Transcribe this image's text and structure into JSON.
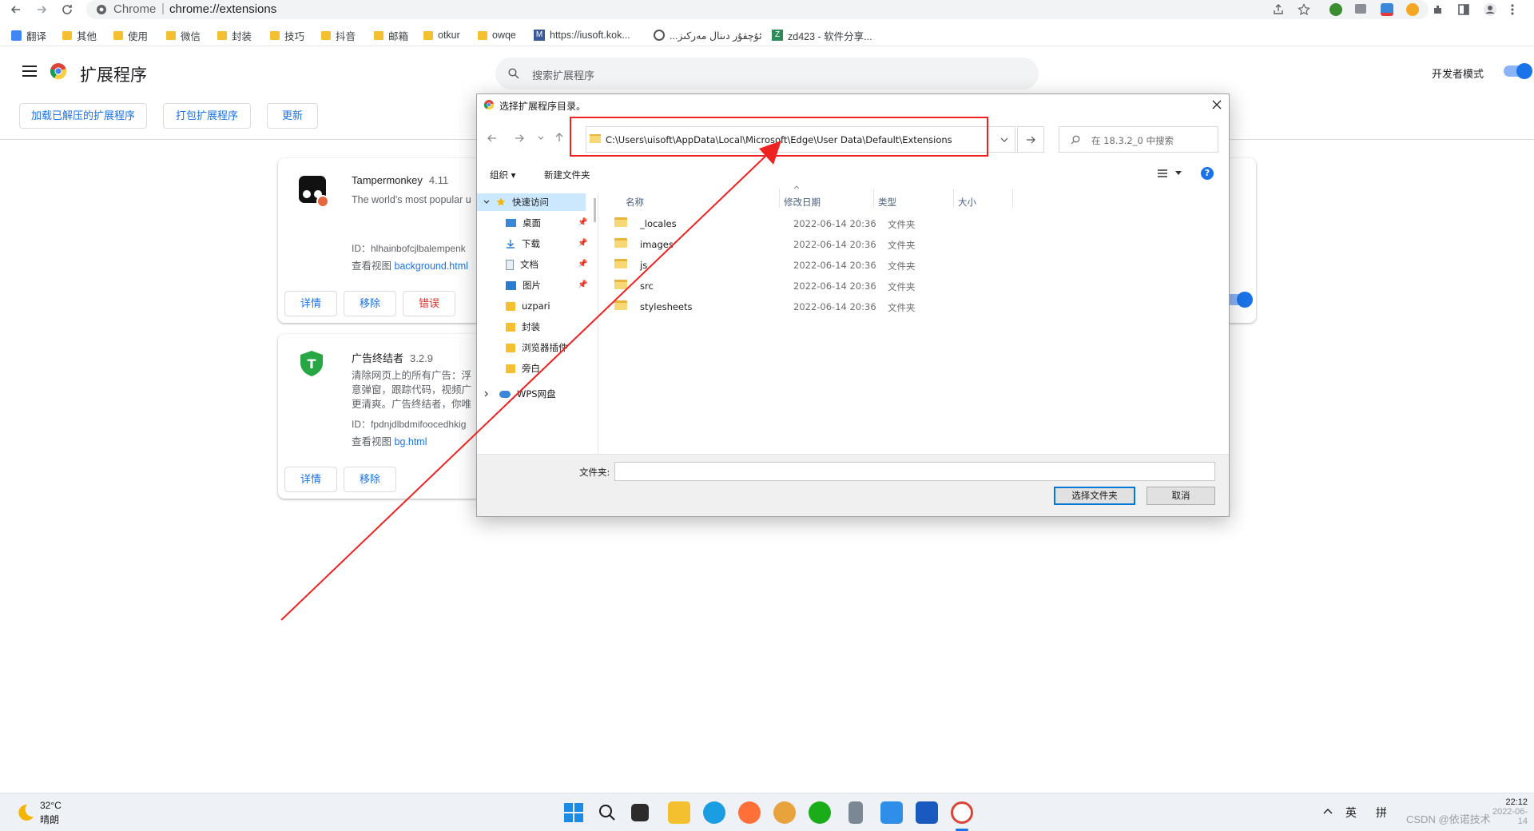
{
  "browser": {
    "site_label": "Chrome",
    "url": "chrome://extensions",
    "bookmarks": [
      {
        "label": "翻译",
        "icon": "translate-icon"
      },
      {
        "label": "其他",
        "icon": "folder-icon"
      },
      {
        "label": "使用",
        "icon": "folder-icon"
      },
      {
        "label": "微信",
        "icon": "folder-icon"
      },
      {
        "label": "封装",
        "icon": "folder-icon"
      },
      {
        "label": "技巧",
        "icon": "folder-icon"
      },
      {
        "label": "抖音",
        "icon": "folder-icon"
      },
      {
        "label": "邮箱",
        "icon": "folder-icon"
      },
      {
        "label": "otkur",
        "icon": "folder-icon"
      },
      {
        "label": "owqe",
        "icon": "folder-icon"
      },
      {
        "label": "https://iusoft.kok...",
        "icon": "site-m-icon"
      },
      {
        "label": "...ئۇچقۇر دىنال مەركىز",
        "icon": "wordpress-icon"
      },
      {
        "label": "zd423 - 软件分享...",
        "icon": "site-z-icon"
      }
    ]
  },
  "extensions_page": {
    "title": "扩展程序",
    "search_placeholder": "搜索扩展程序",
    "developer_mode_label": "开发者模式",
    "developer_mode_on": true,
    "buttons": {
      "load_unpacked": "加载已解压的扩展程序",
      "pack": "打包扩展程序",
      "update": "更新"
    },
    "cards": [
      {
        "name": "Tampermonkey",
        "version": "4.11",
        "description": "The world's most popular u",
        "id_text": "ID：hlhainbofcjlbalempenk",
        "views_label": "查看视图",
        "views_link": "background.html",
        "details_label": "详情",
        "remove_label": "移除",
        "errors_label": "错误"
      },
      {
        "name": "广告终结者",
        "version": "3.2.9",
        "description": "清除网页上的所有广告：浮意弹窗，跟踪代码，视频广更清爽。广告终结者，你唯",
        "id_text": "ID：fpdnjdlbdmifoocedhkig",
        "views_label": "查看视图",
        "views_link": "bg.html",
        "details_label": "详情",
        "remove_label": "移除"
      }
    ]
  },
  "dialog": {
    "title": "选择扩展程序目录。",
    "address_path": "C:\\Users\\uisoft\\AppData\\Local\\Microsoft\\Edge\\User Data\\Default\\Extensions",
    "search_placeholder": "在 18.3.2_0 中搜索",
    "organize_label": "组织 ▾",
    "new_folder_label": "新建文件夹",
    "nav": [
      {
        "label": "快速访问",
        "icon": "star-icon",
        "selected": true,
        "pinned": false
      },
      {
        "label": "桌面",
        "icon": "desktop-icon",
        "selected": false,
        "pinned": true
      },
      {
        "label": "下载",
        "icon": "download-icon",
        "selected": false,
        "pinned": true
      },
      {
        "label": "文档",
        "icon": "document-icon",
        "selected": false,
        "pinned": true
      },
      {
        "label": "图片",
        "icon": "picture-icon",
        "selected": false,
        "pinned": true
      },
      {
        "label": "uzpari",
        "icon": "folder-icon",
        "selected": false,
        "pinned": false
      },
      {
        "label": "封装",
        "icon": "folder-icon",
        "selected": false,
        "pinned": false
      },
      {
        "label": "浏览器插件",
        "icon": "folder-icon",
        "selected": false,
        "pinned": false
      },
      {
        "label": "旁白",
        "icon": "folder-icon",
        "selected": false,
        "pinned": false
      },
      {
        "label": "WPS网盘",
        "icon": "cloud-icon",
        "selected": false,
        "pinned": false
      }
    ],
    "columns": {
      "name": "名称",
      "date": "修改日期",
      "type": "类型",
      "size": "大小"
    },
    "files": [
      {
        "name": "_locales",
        "date": "2022-06-14 20:36",
        "type": "文件夹"
      },
      {
        "name": "images",
        "date": "2022-06-14 20:36",
        "type": "文件夹"
      },
      {
        "name": "js",
        "date": "2022-06-14 20:36",
        "type": "文件夹"
      },
      {
        "name": "src",
        "date": "2022-06-14 20:36",
        "type": "文件夹"
      },
      {
        "name": "stylesheets",
        "date": "2022-06-14 20:36",
        "type": "文件夹"
      }
    ],
    "folder_field_label": "文件夹:",
    "folder_field_value": "",
    "select_button": "选择文件夹",
    "cancel_button": "取消"
  },
  "taskbar": {
    "temperature": "32°C",
    "condition": "晴朗",
    "ime_lang": "英",
    "ime_mode": "拼",
    "time": "22:12",
    "date": "2022-06-14",
    "watermark": "CSDN @依诺技术"
  },
  "annotation_color": "#ee2222"
}
